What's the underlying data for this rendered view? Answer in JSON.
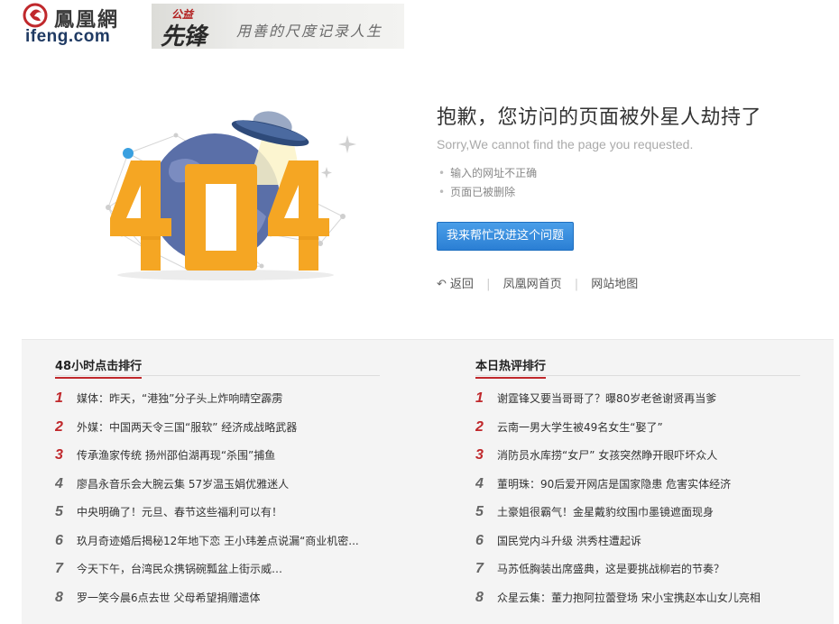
{
  "header": {
    "logo_cn": "鳳凰網",
    "logo_en": "ifeng.com",
    "banner_small": "公益",
    "banner_big": "先锋",
    "banner_slogan": "用善的尺度记录人生"
  },
  "illustration": {
    "error_code": "404"
  },
  "message": {
    "title": "抱歉，您访问的页面被外星人劫持了",
    "subtitle": "Sorry,We cannot find the page you requested.",
    "reasons": [
      "输入的网址不正确",
      "页面已被删除"
    ],
    "help_button": "我来帮忙改进这个问题"
  },
  "links": {
    "back": "返回",
    "home": "凤凰网首页",
    "sitemap": "网站地图"
  },
  "rank_left": {
    "title": "48小时点击排行",
    "items": [
      {
        "num": "1",
        "text": "媒体：昨天，“港独”分子头上炸响晴空霹雳"
      },
      {
        "num": "2",
        "text": "外媒：中国两天令三国“服软” 经济成战略武器"
      },
      {
        "num": "3",
        "text": "传承渔家传统 扬州邵伯湖再现“杀围”捕鱼"
      },
      {
        "num": "4",
        "text": "廖昌永音乐会大腕云集 57岁温玉娟优雅迷人"
      },
      {
        "num": "5",
        "text": "中央明确了！元旦、春节这些福利可以有！"
      },
      {
        "num": "6",
        "text": "玖月奇迹婚后揭秘12年地下恋 王小玮差点说漏“商业机密..."
      },
      {
        "num": "7",
        "text": "今天下午，台湾民众携锅碗瓢盆上街示威…"
      },
      {
        "num": "8",
        "text": "罗一笑今晨6点去世 父母希望捐赠遗体"
      }
    ]
  },
  "rank_right": {
    "title": "本日热评排行",
    "items": [
      {
        "num": "1",
        "text": "谢霆锋又要当哥哥了？曝80岁老爸谢贤再当爹"
      },
      {
        "num": "2",
        "text": "云南一男大学生被49名女生“娶了”"
      },
      {
        "num": "3",
        "text": "消防员水库捞“女尸” 女孩突然睁开眼吓坏众人"
      },
      {
        "num": "4",
        "text": "董明珠：90后爱开网店是国家隐患 危害实体经济"
      },
      {
        "num": "5",
        "text": "土豪姐很霸气！金星戴豹纹围巾墨镜遮面现身"
      },
      {
        "num": "6",
        "text": "国民党内斗升级 洪秀柱遭起诉"
      },
      {
        "num": "7",
        "text": "马苏低胸装出席盛典，这是要挑战柳岩的节奏？"
      },
      {
        "num": "8",
        "text": "众星云集：董力抱阿拉蕾登场 宋小宝携赵本山女儿亮相"
      }
    ]
  },
  "colors": {
    "accent_red": "#c0282c",
    "button_blue": "#2b7fd4",
    "digit_orange": "#f5a623",
    "globe_blue": "#5a6fa8"
  }
}
